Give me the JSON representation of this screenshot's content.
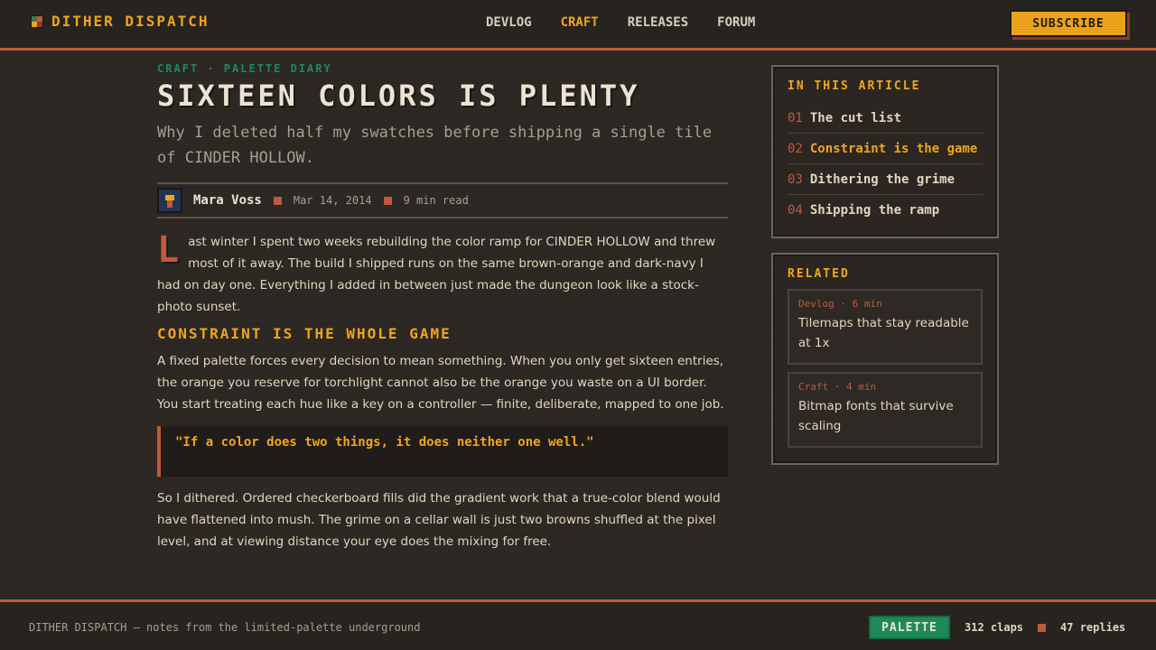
{
  "header": {
    "brand": "DITHER DISPATCH",
    "nav": [
      {
        "label": "DEVLOG",
        "active": false
      },
      {
        "label": "CRAFT",
        "active": true
      },
      {
        "label": "RELEASES",
        "active": false
      },
      {
        "label": "FORUM",
        "active": false
      }
    ],
    "subscribe_label": "SUBSCRIBE"
  },
  "article": {
    "kicker": "CRAFT · PALETTE DIARY",
    "title": "SIXTEEN COLORS IS PLENTY",
    "subtitle": "Why I deleted half my swatches before shipping a single tile of CINDER HOLLOW.",
    "author": "Mara Voss",
    "date": "Mar 14, 2014",
    "read_time": "9 min read",
    "dropcap": "L",
    "p1": "ast winter I spent two weeks rebuilding the color ramp for CINDER HOLLOW and threw most of it away. The build I shipped runs on the same brown-orange and dark-navy I had on day one. Everything I added in between just made the dungeon look like a stock-photo sunset.",
    "h2": "CONSTRAINT IS THE WHOLE GAME",
    "p2": "A fixed palette forces every decision to mean something. When you only get sixteen entries, the orange you reserve for torchlight cannot also be the orange you waste on a UI border. You start treating each hue like a key on a controller — finite, deliberate, mapped to one job.",
    "quote": "\"If a color does two things, it does neither one well.\"",
    "p3": "So I dithered. Ordered checkerboard fills did the gradient work that a true-color blend would have flattened into mush. The grime on a cellar wall is just two browns shuffled at the pixel level, and at viewing distance your eye does the mixing for free."
  },
  "toc": {
    "title": "IN THIS ARTICLE",
    "items": [
      {
        "num": "01",
        "label": "The cut list",
        "active": false
      },
      {
        "num": "02",
        "label": "Constraint is the game",
        "active": true
      },
      {
        "num": "03",
        "label": "Dithering the grime",
        "active": false
      },
      {
        "num": "04",
        "label": "Shipping the ramp",
        "active": false
      }
    ]
  },
  "related": {
    "title": "RELATED",
    "items": [
      {
        "meta": "Devlog · 6 min",
        "title": "Tilemaps that stay readable at 1x"
      },
      {
        "meta": "Craft · 4 min",
        "title": "Bitmap fonts that survive scaling"
      }
    ]
  },
  "footer": {
    "text": "DITHER DISPATCH — notes from the limited-palette underground",
    "palette_label": "PALETTE",
    "claps": "312 claps",
    "replies": "47 replies"
  },
  "colors": {
    "accent_orange": "#f0a51d",
    "rust": "#c1593a",
    "green": "#1f8a59",
    "navy": "#243352",
    "background": "#2e2925"
  }
}
